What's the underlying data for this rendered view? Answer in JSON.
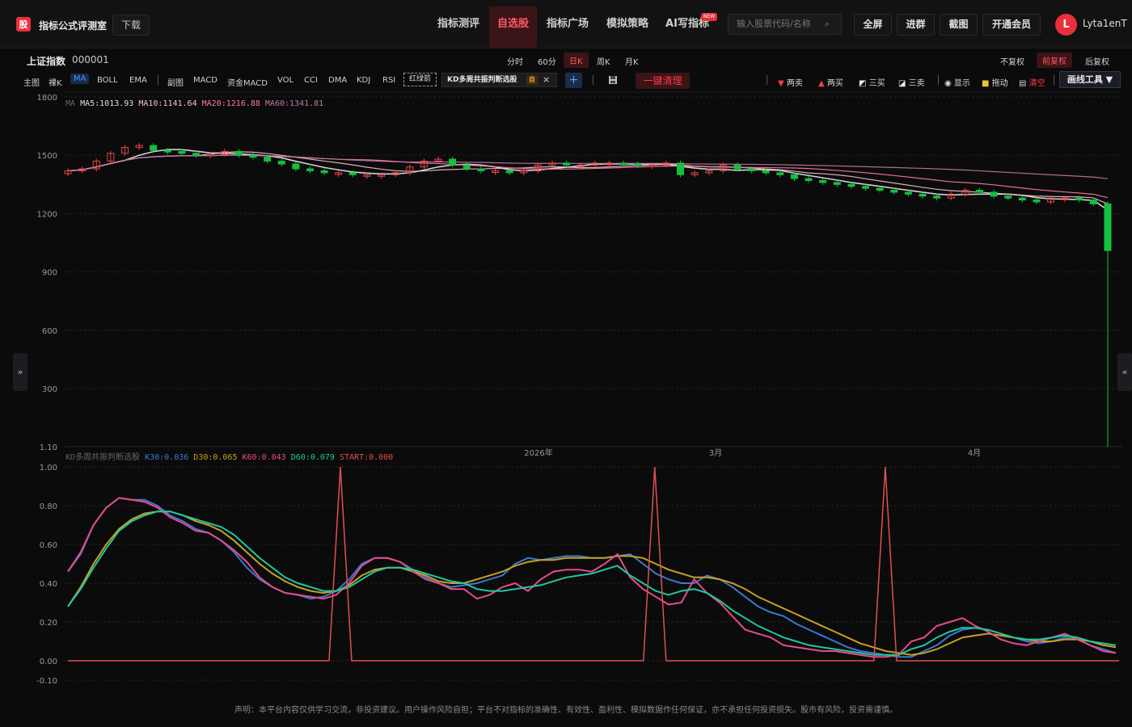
{
  "header": {
    "logo": "股",
    "brand": "指标公式评测室",
    "download": "下载",
    "nav": [
      {
        "label": "指标测评",
        "active": false
      },
      {
        "label": "自选股",
        "active": true
      },
      {
        "label": "指标广场",
        "active": false
      },
      {
        "label": "模拟策略",
        "active": false
      },
      {
        "label": "AI写指标",
        "active": false
      }
    ],
    "new_badge": "NEW",
    "search_placeholder": "输入股票代码/名称",
    "buttons": [
      "全屏",
      "进群",
      "截图",
      "开通会员"
    ],
    "avatar": "L",
    "username": "Lyta1enT"
  },
  "stock": {
    "name": "上证指数",
    "code": "000001"
  },
  "periods": [
    "分时",
    "60分",
    "日K",
    "周K",
    "月K"
  ],
  "active_period": "日K",
  "fuquan": [
    "不复权",
    "前复权",
    "后复权"
  ],
  "active_fuquan": "前复权",
  "indicators": {
    "main_label": "主图",
    "bare": "裸K",
    "ma": "MA",
    "boll": "BOLL",
    "ema": "EMA",
    "sub_label": "副图",
    "macd": "MACD",
    "fund_macd": "资金MACD",
    "vol": "VOL",
    "cci": "CCI",
    "dma": "DMA",
    "kdj": "KDJ",
    "rsi": "RSI",
    "hong": "红绿箭",
    "kd_tab": "KD多周共振判断选股",
    "lock": "自",
    "clear": "一键清理"
  },
  "tools": {
    "two_sell": "两卖",
    "two_buy": "两买",
    "three_buy": "三买",
    "three_sell": "三卖",
    "show": "显示",
    "drag": "拖动",
    "clear": "清空",
    "draw": "画线工具 ▼"
  },
  "ma_legend": {
    "label": "MA",
    "ma5": "MA5:1013.93",
    "ma10": "MA10:1141.64",
    "ma20": "MA20:1216.88",
    "ma60": "MA60:1341.81",
    "colors": {
      "ma5": "#e8e8e8",
      "ma10": "#f5c0c8",
      "ma20": "#ff7aa0",
      "ma60": "#c07aa8"
    }
  },
  "kd_legend": {
    "label": "KD多周共振判断选股",
    "k30": "K30:0.036",
    "d30": "D30:0.065",
    "k60": "K60:0.043",
    "d60": "D60:0.079",
    "start": "START:0.000",
    "colors": {
      "k30": "#3a78d0",
      "d30": "#c8a020",
      "k60": "#e84a8a",
      "d60": "#1ec8a0",
      "start": "#e05050"
    }
  },
  "axis": {
    "main_ticks": [
      "1800",
      "1500",
      "1200",
      "900",
      "600",
      "300",
      "1.10"
    ],
    "sub_ticks": [
      "1.00",
      "0.80",
      "0.60",
      "0.40",
      "0.20",
      "0.00",
      "-0.10"
    ],
    "time_labels": [
      "2026年",
      "3月",
      "4月"
    ]
  },
  "footer": "声明：本平台内容仅供学习交流，非投资建议。用户操作风险自担；平台不对指标的准确性、有效性、盈利性、模拟数据作任何保证，亦不承担任何投资损失。股市有风险，投资需谨慎。",
  "chart_data": {
    "type": "line",
    "main": {
      "ylim": [
        1.1,
        1800
      ],
      "candles_close": [
        1420,
        1430,
        1470,
        1510,
        1540,
        1550,
        1525,
        1520,
        1510,
        1500,
        1505,
        1520,
        1500,
        1490,
        1470,
        1455,
        1430,
        1420,
        1410,
        1410,
        1400,
        1400,
        1400,
        1410,
        1440,
        1470,
        1480,
        1450,
        1430,
        1420,
        1420,
        1410,
        1420,
        1450,
        1460,
        1450,
        1450,
        1460,
        1460,
        1455,
        1450,
        1450,
        1460,
        1400,
        1410,
        1420,
        1450,
        1430,
        1420,
        1410,
        1400,
        1380,
        1370,
        1360,
        1350,
        1340,
        1330,
        1320,
        1310,
        1300,
        1290,
        1280,
        1300,
        1320,
        1310,
        1290,
        1280,
        1270,
        1260,
        1280,
        1280,
        1270,
        1250,
        1010
      ],
      "ma60_end": 1341.81,
      "last_close_spike_low": 1.1
    },
    "sub": {
      "ylim": [
        -0.1,
        1.0
      ],
      "series": [
        {
          "name": "K30",
          "values": [
            0.46,
            0.55,
            0.7,
            0.79,
            0.84,
            0.83,
            0.83,
            0.8,
            0.75,
            0.72,
            0.68,
            0.66,
            0.62,
            0.56,
            0.48,
            0.42,
            0.38,
            0.35,
            0.34,
            0.32,
            0.33,
            0.36,
            0.42,
            0.5,
            0.53,
            0.53,
            0.51,
            0.47,
            0.43,
            0.4,
            0.38,
            0.39,
            0.4,
            0.42,
            0.44,
            0.5,
            0.53,
            0.52,
            0.53,
            0.54,
            0.54,
            0.53,
            0.53,
            0.54,
            0.55,
            0.5,
            0.45,
            0.42,
            0.4,
            0.4,
            0.44,
            0.42,
            0.38,
            0.33,
            0.28,
            0.25,
            0.23,
            0.19,
            0.16,
            0.13,
            0.1,
            0.07,
            0.05,
            0.04,
            0.03,
            0.02,
            0.02,
            0.05,
            0.08,
            0.13,
            0.16,
            0.17,
            0.16,
            0.14,
            0.12,
            0.1,
            0.09,
            0.1,
            0.12,
            0.11,
            0.08,
            0.06,
            0.04
          ]
        },
        {
          "name": "D30",
          "values": [
            0.28,
            0.38,
            0.5,
            0.6,
            0.68,
            0.73,
            0.76,
            0.77,
            0.77,
            0.75,
            0.72,
            0.7,
            0.67,
            0.62,
            0.56,
            0.5,
            0.45,
            0.41,
            0.38,
            0.36,
            0.35,
            0.36,
            0.39,
            0.44,
            0.47,
            0.48,
            0.48,
            0.46,
            0.44,
            0.41,
            0.4,
            0.4,
            0.42,
            0.44,
            0.46,
            0.49,
            0.51,
            0.52,
            0.52,
            0.53,
            0.53,
            0.53,
            0.53,
            0.54,
            0.54,
            0.53,
            0.5,
            0.47,
            0.45,
            0.43,
            0.43,
            0.42,
            0.4,
            0.37,
            0.33,
            0.3,
            0.27,
            0.24,
            0.21,
            0.18,
            0.15,
            0.12,
            0.09,
            0.07,
            0.05,
            0.04,
            0.03,
            0.04,
            0.06,
            0.09,
            0.12,
            0.13,
            0.14,
            0.13,
            0.12,
            0.11,
            0.1,
            0.1,
            0.11,
            0.11,
            0.1,
            0.08,
            0.07
          ]
        },
        {
          "name": "K60",
          "values": [
            0.46,
            0.56,
            0.7,
            0.79,
            0.84,
            0.83,
            0.82,
            0.79,
            0.74,
            0.71,
            0.67,
            0.66,
            0.62,
            0.57,
            0.51,
            0.43,
            0.38,
            0.35,
            0.34,
            0.33,
            0.32,
            0.34,
            0.4,
            0.49,
            0.53,
            0.53,
            0.51,
            0.46,
            0.42,
            0.4,
            0.37,
            0.37,
            0.32,
            0.34,
            0.38,
            0.4,
            0.36,
            0.42,
            0.46,
            0.47,
            0.47,
            0.46,
            0.5,
            0.55,
            0.43,
            0.37,
            0.33,
            0.29,
            0.3,
            0.42,
            0.35,
            0.3,
            0.23,
            0.16,
            0.14,
            0.12,
            0.08,
            0.07,
            0.06,
            0.05,
            0.05,
            0.04,
            0.03,
            0.02,
            0.02,
            0.03,
            0.1,
            0.12,
            0.18,
            0.2,
            0.22,
            0.18,
            0.15,
            0.11,
            0.09,
            0.08,
            0.1,
            0.12,
            0.14,
            0.11,
            0.08,
            0.05,
            0.04
          ]
        },
        {
          "name": "D60",
          "values": [
            0.28,
            0.37,
            0.48,
            0.58,
            0.67,
            0.72,
            0.75,
            0.77,
            0.77,
            0.75,
            0.73,
            0.71,
            0.69,
            0.65,
            0.59,
            0.53,
            0.48,
            0.43,
            0.4,
            0.38,
            0.36,
            0.36,
            0.38,
            0.42,
            0.46,
            0.48,
            0.48,
            0.47,
            0.45,
            0.43,
            0.41,
            0.4,
            0.37,
            0.36,
            0.36,
            0.37,
            0.38,
            0.39,
            0.41,
            0.43,
            0.44,
            0.45,
            0.47,
            0.49,
            0.44,
            0.4,
            0.36,
            0.34,
            0.36,
            0.37,
            0.35,
            0.31,
            0.26,
            0.22,
            0.18,
            0.15,
            0.12,
            0.1,
            0.08,
            0.07,
            0.06,
            0.05,
            0.04,
            0.03,
            0.03,
            0.03,
            0.06,
            0.08,
            0.12,
            0.15,
            0.17,
            0.17,
            0.16,
            0.14,
            0.12,
            0.11,
            0.11,
            0.12,
            0.13,
            0.12,
            0.1,
            0.09,
            0.08
          ]
        },
        {
          "name": "START",
          "spikes_at": [
            0.26,
            0.56,
            0.78
          ],
          "value": 1.0
        }
      ]
    }
  }
}
